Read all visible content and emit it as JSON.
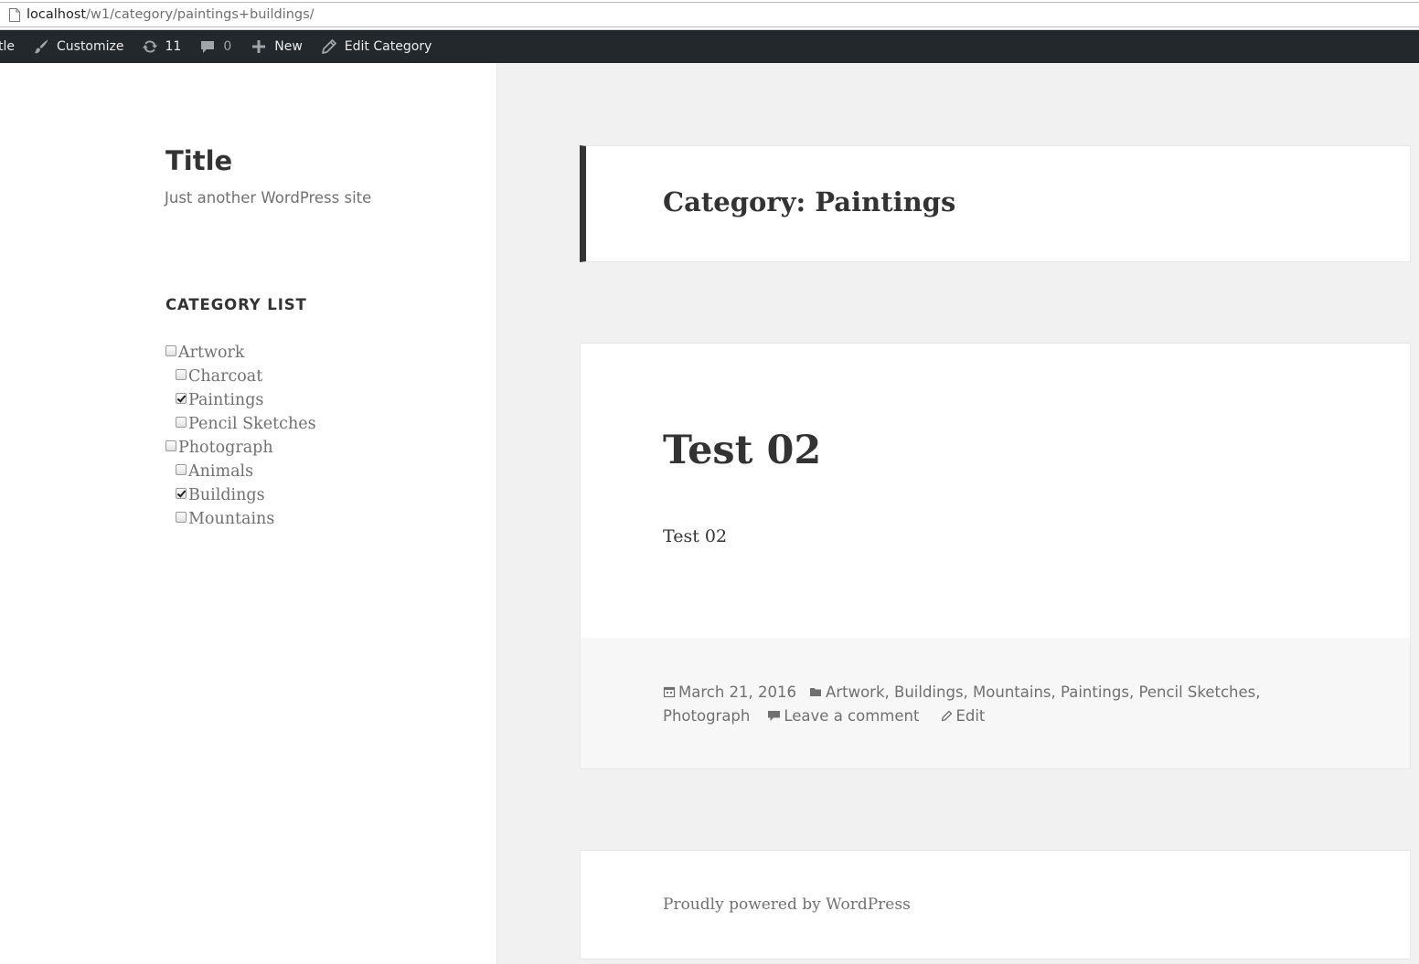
{
  "browser": {
    "url_host": "localhost",
    "url_path": "/w1/category/paintings+buildings/"
  },
  "adminbar": {
    "site_name": "tle",
    "customize_label": "Customize",
    "updates_count": "11",
    "comments_count": "0",
    "new_label": "New",
    "edit_label": "Edit Category",
    "icons": [
      "customize-brush-icon",
      "updates-icon",
      "comment-bubble-icon",
      "plus-icon",
      "pencil-icon"
    ]
  },
  "sidebar": {
    "site_title": "Title",
    "site_description": "Just another WordPress site",
    "widget_title": "CATEGORY LIST",
    "categories": [
      {
        "label": "Artwork",
        "checked": false,
        "level": 0
      },
      {
        "label": "Charcoat",
        "checked": false,
        "level": 1
      },
      {
        "label": "Paintings",
        "checked": true,
        "level": 1
      },
      {
        "label": "Pencil Sketches",
        "checked": false,
        "level": 1
      },
      {
        "label": "Photograph",
        "checked": false,
        "level": 0
      },
      {
        "label": "Animals",
        "checked": false,
        "level": 1
      },
      {
        "label": "Buildings",
        "checked": true,
        "level": 1
      },
      {
        "label": "Mountains",
        "checked": false,
        "level": 1
      }
    ]
  },
  "archive": {
    "title": "Category: Paintings"
  },
  "post": {
    "title": "Test 02",
    "content": "Test 02",
    "date": "March 21, 2016",
    "categories": [
      "Artwork",
      "Buildings",
      "Mountains",
      "Paintings",
      "Pencil Sketches",
      "Photograph"
    ],
    "comment_link": "Leave a comment",
    "edit_link": "Edit"
  },
  "footer": {
    "powered_by": "Proudly powered by WordPress"
  },
  "colors": {
    "adminbar_bg": "#23282d",
    "page_bg": "#f1f1f1",
    "accent_border": "#333333",
    "meta_text": "#707070"
  }
}
